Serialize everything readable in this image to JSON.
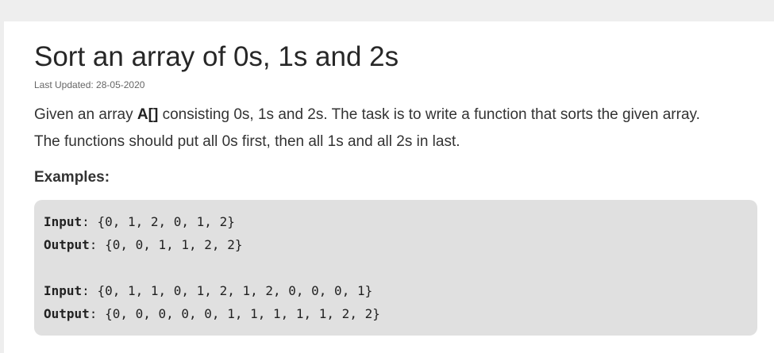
{
  "article": {
    "title": "Sort an array of 0s, 1s and 2s",
    "last_updated": "Last Updated: 28-05-2020",
    "description": {
      "line1_before": "Given an array ",
      "line1_bold": "A[]",
      "line1_after": " consisting 0s, 1s and 2s. The task is to write a function that sorts the given array.",
      "line2": "The functions should put all 0s first, then all 1s and all 2s in last."
    },
    "examples_heading": "Examples:",
    "examples": [
      {
        "input_label": "Input",
        "input_value": ": {0, 1, 2, 0, 1, 2}",
        "output_label": "Output",
        "output_value": ": {0, 0, 1, 1, 2, 2}"
      },
      {
        "input_label": "Input",
        "input_value": ": {0, 1, 1, 0, 1, 2, 1, 2, 0, 0, 0, 1}",
        "output_label": "Output",
        "output_value": ": {0, 0, 0, 0, 0, 1, 1, 1, 1, 1, 2, 2}"
      }
    ]
  }
}
